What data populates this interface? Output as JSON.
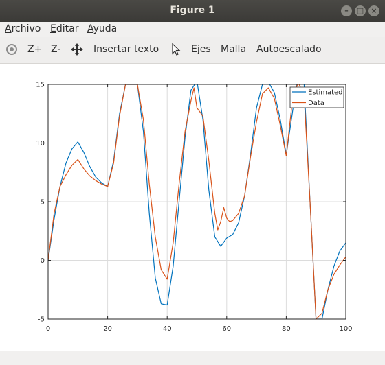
{
  "window": {
    "title": "Figure 1"
  },
  "menu": {
    "archivo_first": "A",
    "archivo_rest": "rchivo",
    "editar_first": "E",
    "editar_rest": "ditar",
    "ayuda_first": "A",
    "ayuda_rest": "yuda"
  },
  "toolbar": {
    "zoom_in": "Z+",
    "zoom_out": "Z-",
    "insert_text": "Insertar texto",
    "axes": "Ejes",
    "grid": "Malla",
    "autoscale": "Autoescalado"
  },
  "colors": {
    "series1": "#0072bd",
    "series2": "#d95319",
    "grid": "#dcdcdc"
  },
  "chart_data": {
    "type": "line",
    "xlim": [
      0,
      100
    ],
    "ylim": [
      -5,
      15
    ],
    "xticks": [
      "0",
      "20",
      "40",
      "60",
      "80",
      "100"
    ],
    "yticks": [
      "-5",
      "0",
      "5",
      "10",
      "15"
    ],
    "grid": true,
    "legend_position": "top-right",
    "series": [
      {
        "name": "Estimated",
        "x": [
          0,
          2,
          4,
          6,
          8,
          10,
          12,
          14,
          16,
          18,
          20,
          22,
          24,
          26,
          28,
          30,
          32,
          34,
          36,
          38,
          40,
          42,
          44,
          46,
          48,
          50,
          52,
          54,
          56,
          58,
          60,
          62,
          64,
          66,
          68,
          70,
          72,
          74,
          76,
          78,
          80,
          82,
          84,
          86,
          88,
          90,
          92,
          94,
          96,
          98,
          100
        ],
        "y": [
          0,
          3.5,
          6.3,
          8.3,
          9.5,
          10.1,
          9.2,
          8,
          7.1,
          6.6,
          6.3,
          8.5,
          12.5,
          15,
          15,
          15,
          11,
          4,
          -1.5,
          -3.7,
          -3.8,
          -0.5,
          5,
          10.5,
          14.5,
          15.3,
          12,
          6,
          2,
          1.2,
          1.9,
          2.2,
          3.2,
          5.5,
          9,
          13,
          15,
          15.2,
          14.3,
          12,
          9,
          12.5,
          16,
          15,
          5,
          -5,
          -5,
          -2.5,
          -0.5,
          0.8,
          1.5
        ]
      },
      {
        "name": "Data",
        "x": [
          0,
          2,
          4,
          6,
          8,
          10,
          12,
          14,
          16,
          18,
          20,
          22,
          24,
          26,
          28,
          30,
          32,
          34,
          36,
          38,
          40,
          42,
          44,
          46,
          48,
          49,
          50,
          52,
          54,
          56,
          57,
          58,
          59,
          60,
          61,
          62,
          64,
          66,
          68,
          70,
          72,
          74,
          76,
          78,
          80,
          82,
          84,
          86,
          88,
          90,
          92,
          94,
          96,
          98,
          100
        ],
        "y": [
          0,
          4,
          6.3,
          7.3,
          8.1,
          8.6,
          7.8,
          7.2,
          6.8,
          6.5,
          6.3,
          8.3,
          12.3,
          15,
          15,
          15,
          12,
          6.5,
          2,
          -0.8,
          -1.6,
          1.5,
          6.5,
          11,
          13.6,
          14.7,
          13,
          12.3,
          8.5,
          4,
          2.6,
          3.3,
          4.5,
          3.6,
          3.3,
          3.4,
          4,
          5.5,
          8.8,
          11.8,
          14.2,
          14.7,
          13.8,
          11.5,
          8.9,
          13.5,
          15.2,
          14,
          5,
          -5,
          -4.5,
          -2.5,
          -1.2,
          -0.4,
          0.3
        ]
      }
    ]
  }
}
